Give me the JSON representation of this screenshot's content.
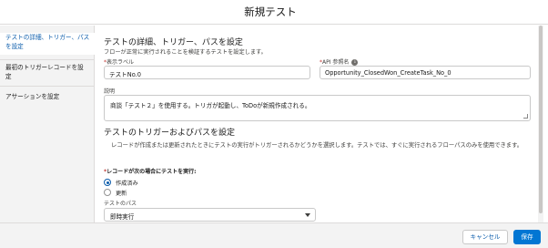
{
  "modal": {
    "title": "新規テスト"
  },
  "sidebar": {
    "items": [
      {
        "label": "テストの詳細、トリガー、パスを設定",
        "active": true
      },
      {
        "label": "最初のトリガーレコードを設定",
        "active": false
      },
      {
        "label": "アサーションを設定",
        "active": false
      }
    ]
  },
  "details": {
    "heading": "テストの詳細、トリガー、パスを設定",
    "subtitle": "フローが正常に実行されることを検証するテストを設定します。",
    "display_label": {
      "label": "表示ラベル",
      "value": "テストNo.0"
    },
    "api_name": {
      "label": "API 参照名",
      "value": "Opportunity_ClosedWon_CreateTask_No_0"
    },
    "description": {
      "label": "説明",
      "value": "商談「テスト２」を使用する。トリガが起動し、ToDoが新規作成される。"
    }
  },
  "trigger": {
    "heading": "テストのトリガーおよびパスを設定",
    "description": "レコードが作成または更新されたときにテストの実行がトリガーされるかどうかを選択します。テストでは、すぐに実行されるフローパスのみを使用できます。",
    "run_label": "レコードが次の場合にテストを実行:",
    "options": [
      {
        "label": "作成済み",
        "checked": true
      },
      {
        "label": "更新",
        "checked": false
      }
    ],
    "path_label": "テストのパス",
    "path_value": "即時実行"
  },
  "footer": {
    "cancel_label": "キャンセル",
    "save_label": "保存"
  },
  "colors": {
    "brand": "#0176d3",
    "active_link": "#0b5cab",
    "required": "#c23934"
  }
}
